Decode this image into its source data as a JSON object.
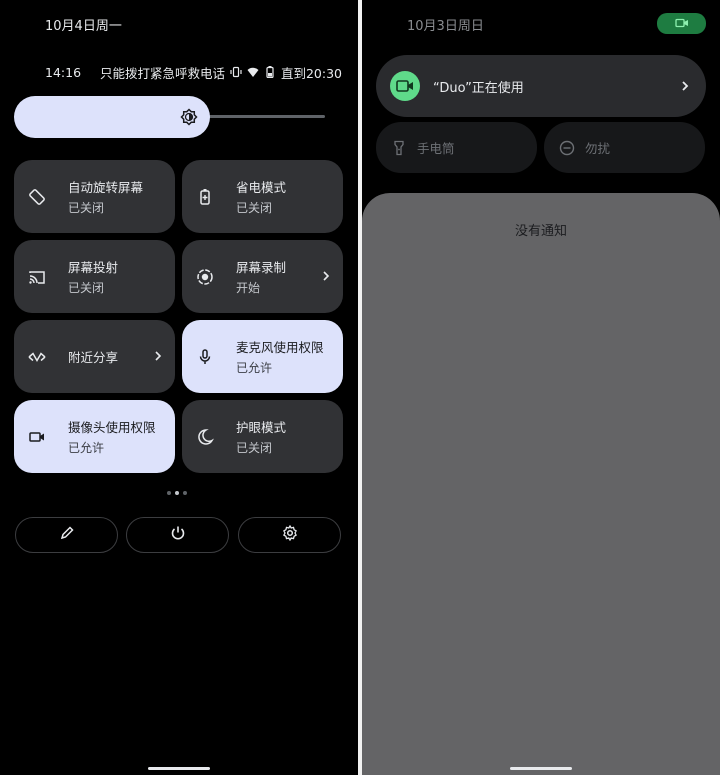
{
  "left": {
    "date": "10月4日周一",
    "status": {
      "time": "14:16",
      "carrier": "只能拨打紧急呼救电话",
      "battery_text": "直到20:30"
    },
    "brightness": {
      "level": 0.63
    },
    "tiles": [
      {
        "title": "自动旋转屏幕",
        "subtitle": "已关闭",
        "icon": "auto-rotate-icon",
        "on": false
      },
      {
        "title": "省电模式",
        "subtitle": "已关闭",
        "icon": "battery-saver-icon",
        "on": false
      },
      {
        "title": "屏幕投射",
        "subtitle": "已关闭",
        "icon": "cast-icon",
        "on": false
      },
      {
        "title": "屏幕录制",
        "subtitle": "开始",
        "icon": "screen-record-icon",
        "on": false
      },
      {
        "title": "附近分享",
        "subtitle": "",
        "icon": "nearby-share-icon",
        "on": false
      },
      {
        "title": "麦克风使用权限",
        "subtitle": "已允许",
        "icon": "microphone-icon",
        "on": true
      },
      {
        "title": "摄像头使用权限",
        "subtitle": "已允许",
        "icon": "camera-icon",
        "on": true
      },
      {
        "title": "护眼模式",
        "subtitle": "已关闭",
        "icon": "moon-icon",
        "on": false
      }
    ],
    "page_dots": {
      "count": 3,
      "active": 1
    },
    "bottom_buttons": [
      "edit-icon",
      "power-icon",
      "settings-icon"
    ]
  },
  "right": {
    "date": "10月3日周日",
    "privacy_chip_icon": "camera-icon",
    "duo": {
      "label": "“Duo”正在使用",
      "icon": "video-camera-icon"
    },
    "quick": [
      {
        "label": "手电筒",
        "icon": "flashlight-icon"
      },
      {
        "label": "勿扰",
        "icon": "do-not-disturb-icon"
      }
    ],
    "no_notifications": "没有通知"
  },
  "colors": {
    "tile_on": "#dde2fb",
    "tile_off": "#313235",
    "duo_green": "#5fda8a",
    "privacy_chip": "#1e7c41",
    "notification_shade": "#646466"
  }
}
